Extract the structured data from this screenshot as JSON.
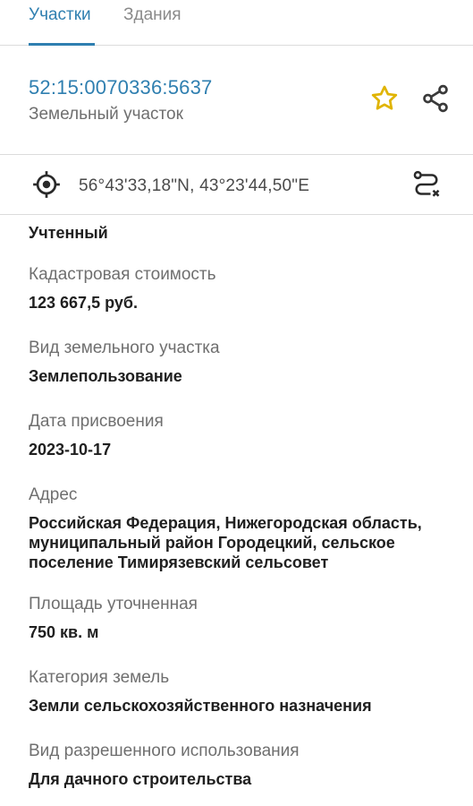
{
  "tabs": [
    {
      "label": "Участки",
      "active": true
    },
    {
      "label": "Здания",
      "active": false
    }
  ],
  "header": {
    "cadastral_number": "52:15:0070336:5637",
    "object_type": "Земельный участок",
    "star_icon": "star-icon",
    "share_icon": "share-icon"
  },
  "coords": {
    "text": "56°43'33,18\"N, 43°23'44,50\"E",
    "locate_icon": "crosshair-icon",
    "route_icon": "route-icon"
  },
  "status": "Учтенный",
  "fields": [
    {
      "label": "Кадастровая стоимость",
      "value": "123 667,5 руб."
    },
    {
      "label": "Вид земельного участка",
      "value": "Землепользование"
    },
    {
      "label": "Дата присвоения",
      "value": "2023-10-17"
    },
    {
      "label": "Адрес",
      "value": "Российская Федерация, Нижегородская область, муниципальный район Городецкий, сельское поселение Тимирязевский сельсовет"
    },
    {
      "label": "Площадь уточненная",
      "value": "750 кв. м"
    },
    {
      "label": "Категория земель",
      "value": "Земли сельскохозяйственного назначения"
    },
    {
      "label": "Вид разрешенного использования",
      "value": "Для дачного строительства"
    }
  ],
  "colors": {
    "accent": "#2f7fb0",
    "star": "#e0b400"
  }
}
